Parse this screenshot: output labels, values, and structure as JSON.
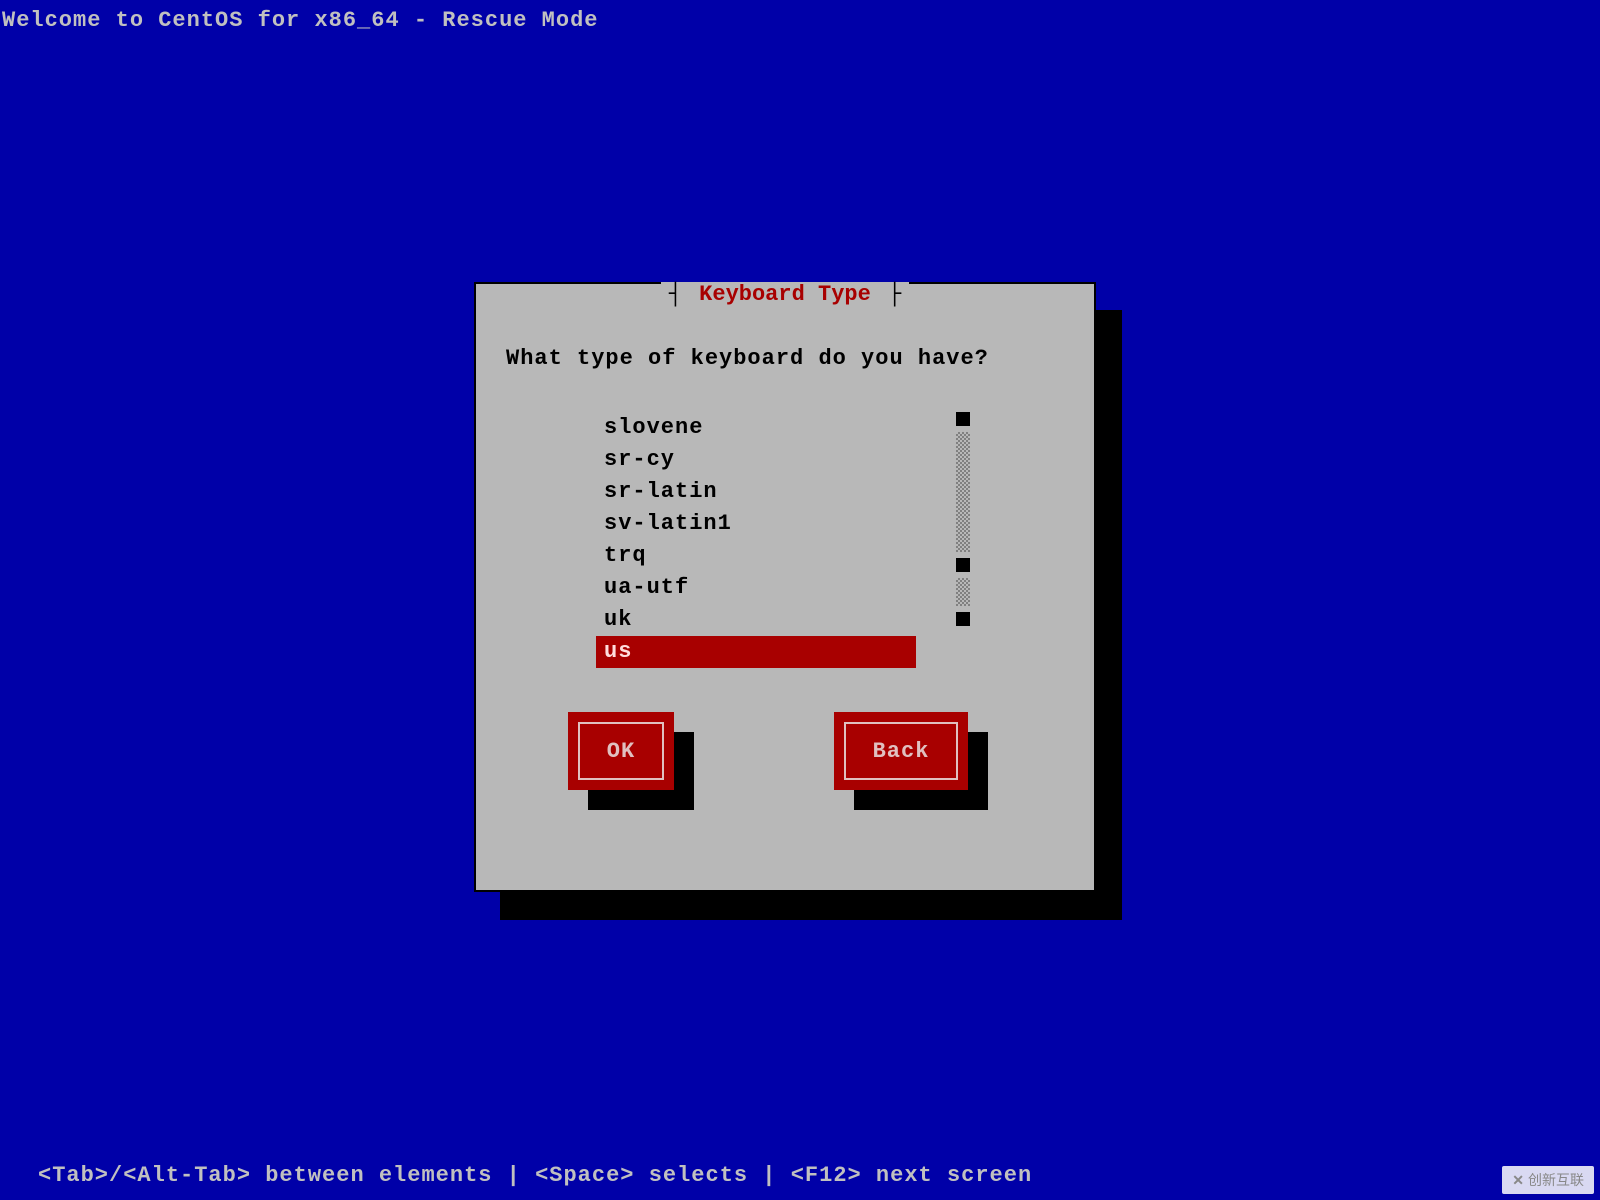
{
  "header": "Welcome to CentOS for x86_64 - Rescue Mode",
  "dialog": {
    "title": "Keyboard Type",
    "prompt": "What type of keyboard do you have?",
    "items": [
      {
        "label": "slovene",
        "selected": false
      },
      {
        "label": "sr-cy",
        "selected": false
      },
      {
        "label": "sr-latin",
        "selected": false
      },
      {
        "label": "sv-latin1",
        "selected": false
      },
      {
        "label": "trq",
        "selected": false
      },
      {
        "label": "ua-utf",
        "selected": false
      },
      {
        "label": "uk",
        "selected": false
      },
      {
        "label": "us",
        "selected": true
      }
    ],
    "buttons": {
      "ok": "OK",
      "back": "Back"
    }
  },
  "footer": "<Tab>/<Alt-Tab> between elements   |  <Space> selects |  <F12> next screen",
  "watermark": "创新互联"
}
